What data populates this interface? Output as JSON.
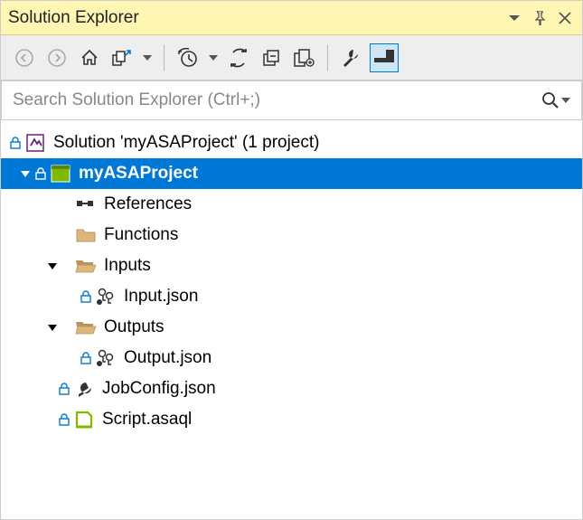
{
  "panel": {
    "title": "Solution Explorer"
  },
  "search": {
    "placeholder": "Search Solution Explorer (Ctrl+;)"
  },
  "tree": {
    "solution": "Solution 'myASAProject' (1 project)",
    "project": "myASAProject",
    "references": "References",
    "functions": "Functions",
    "inputs": "Inputs",
    "input_json": "Input.json",
    "outputs": "Outputs",
    "output_json": "Output.json",
    "jobconfig": "JobConfig.json",
    "script": "Script.asaql"
  }
}
